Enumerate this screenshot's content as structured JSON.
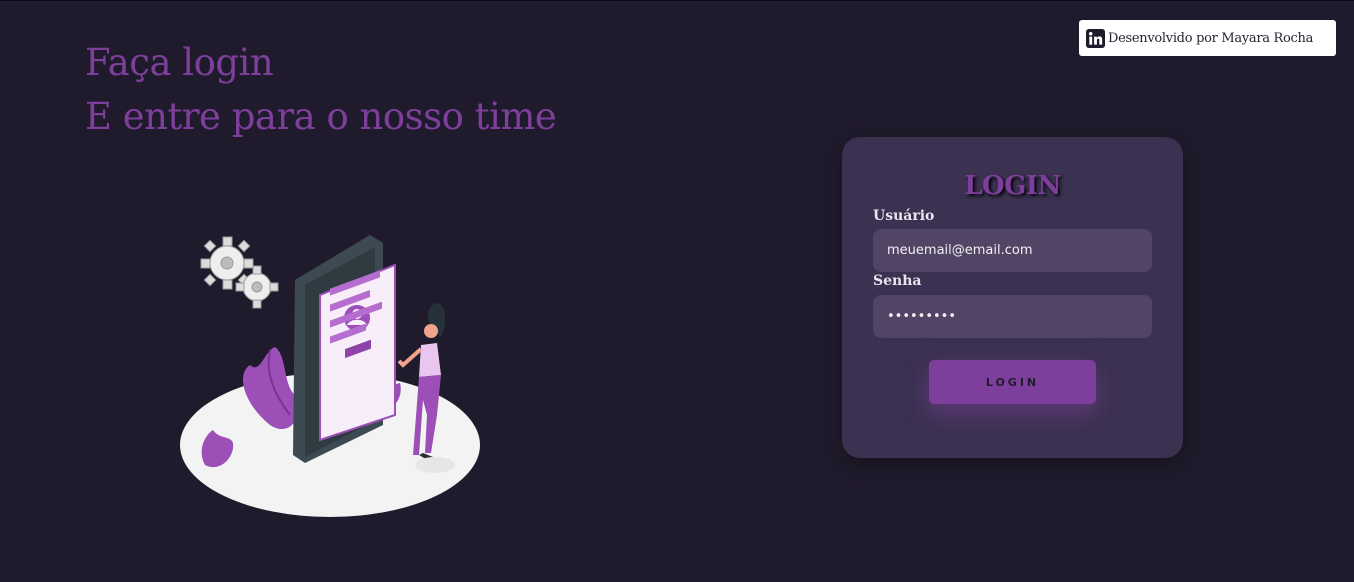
{
  "headline": {
    "line1": "Faça login",
    "line2": "E entre para o nosso time"
  },
  "credit": {
    "text": "Desenvolvido por Mayara Rocha",
    "icon": "linkedin-icon"
  },
  "illustration": {
    "icon": "login-illustration"
  },
  "login_card": {
    "title": "LOGIN",
    "username": {
      "label": "Usuário",
      "value": "meuemail@email.com"
    },
    "password": {
      "label": "Senha",
      "value": "•••••••••"
    },
    "submit_label": "LOGIN"
  },
  "colors": {
    "background": "#201b2c",
    "accent": "#7e3f9c",
    "card": "#3b3150",
    "input": "#514464"
  }
}
